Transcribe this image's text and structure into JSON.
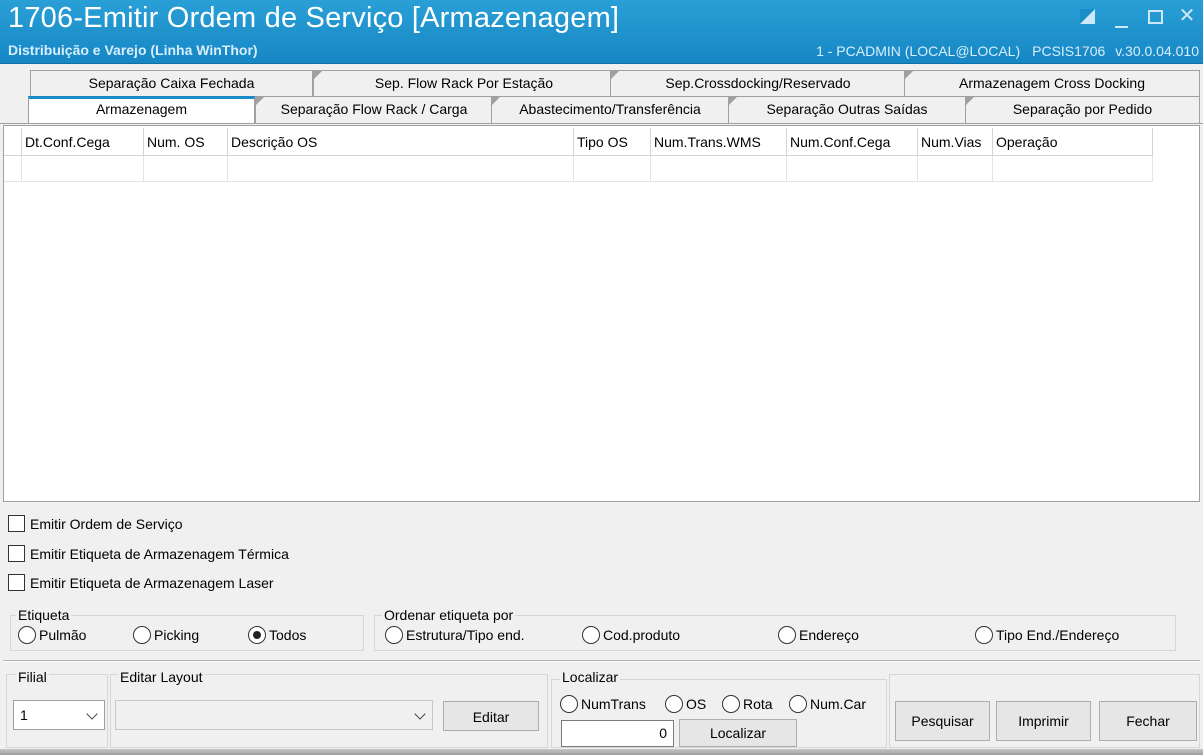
{
  "window": {
    "title": "1706-Emitir Ordem de Serviço [Armazenagem]",
    "subtitle": "Distribuição e Varejo (Linha WinThor)",
    "user": "1 - PCADMIN (LOCAL@LOCAL)",
    "program": "PCSIS1706",
    "version": "v.30.0.04.010"
  },
  "tabs": {
    "row1": [
      {
        "label": "Separação Caixa Fechada"
      },
      {
        "label": "Sep. Flow Rack Por Estação"
      },
      {
        "label": "Sep.Crossdocking/Reservado"
      },
      {
        "label": "Armazenagem Cross Docking"
      }
    ],
    "row2": [
      {
        "label": "Armazenagem",
        "active": true
      },
      {
        "label": "Separação Flow Rack / Carga"
      },
      {
        "label": "Abastecimento/Transferência"
      },
      {
        "label": "Separação Outras Saídas"
      },
      {
        "label": "Separação por Pedido"
      }
    ]
  },
  "grid": {
    "columns": [
      "Dt.Conf.Cega",
      "Num. OS",
      "Descrição OS",
      "Tipo OS",
      "Num.Trans.WMS",
      "Num.Conf.Cega",
      "Num.Vias",
      "Operação"
    ],
    "rows": []
  },
  "options": {
    "emitir_os": {
      "label": "Emitir Ordem de Serviço",
      "checked": false
    },
    "etiqueta_termica": {
      "label": "Emitir Etiqueta de Armazenagem Térmica",
      "checked": false
    },
    "etiqueta_laser": {
      "label": "Emitir Etiqueta de Armazenagem Laser",
      "checked": false
    }
  },
  "etiqueta": {
    "label": "Etiqueta",
    "options": [
      "Pulmão",
      "Picking",
      "Todos"
    ],
    "selected": "Todos"
  },
  "ordenar": {
    "label": "Ordenar etiqueta por",
    "options": [
      "Estrutura/Tipo end.",
      "Cod.produto",
      "Endereço",
      "Tipo End./Endereço"
    ],
    "selected": null
  },
  "filial": {
    "label": "Filial",
    "value": "1"
  },
  "editar_layout": {
    "label": "Editar Layout",
    "value": "",
    "button": "Editar"
  },
  "localizar": {
    "label": "Localizar",
    "options": [
      "NumTrans",
      "OS",
      "Rota",
      "Num.Car"
    ],
    "selected": null,
    "value": "0",
    "button": "Localizar"
  },
  "actions": {
    "pesquisar": "Pesquisar",
    "imprimir": "Imprimir",
    "fechar": "Fechar"
  }
}
